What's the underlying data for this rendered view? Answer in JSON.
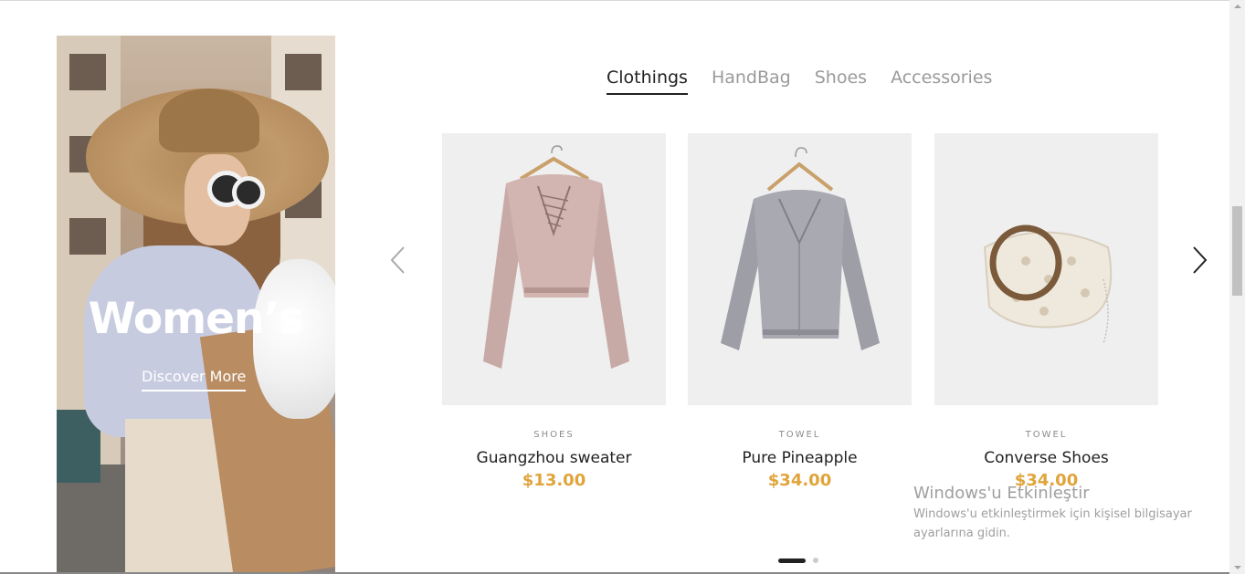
{
  "banner": {
    "title": "Women’s",
    "cta": "Discover More"
  },
  "tabs": [
    {
      "label": "Clothings",
      "active": true
    },
    {
      "label": "HandBag",
      "active": false
    },
    {
      "label": "Shoes",
      "active": false
    },
    {
      "label": "Accessories",
      "active": false
    }
  ],
  "products": [
    {
      "category": "SHOES",
      "name": "Guangzhou sweater",
      "price": "$13.00",
      "image_icon": "pink-sweater-icon"
    },
    {
      "category": "TOWEL",
      "name": "Pure Pineapple",
      "price": "$34.00",
      "image_icon": "grey-sweater-icon"
    },
    {
      "category": "TOWEL",
      "name": "Converse Shoes",
      "price": "$34.00",
      "image_icon": "rattan-handbag-icon"
    }
  ],
  "carousel": {
    "prev_icon": "chevron-left-icon",
    "next_icon": "chevron-right-icon"
  },
  "colors": {
    "price": "#e0a43a",
    "text": "#222222",
    "muted": "#9a9a9a",
    "image_bg": "#efefef"
  },
  "watermark": {
    "title": "Windows'u Etkinleştir",
    "text": "Windows'u etkinleştirmek için kişisel bilgisayar ayarlarına gidin."
  }
}
